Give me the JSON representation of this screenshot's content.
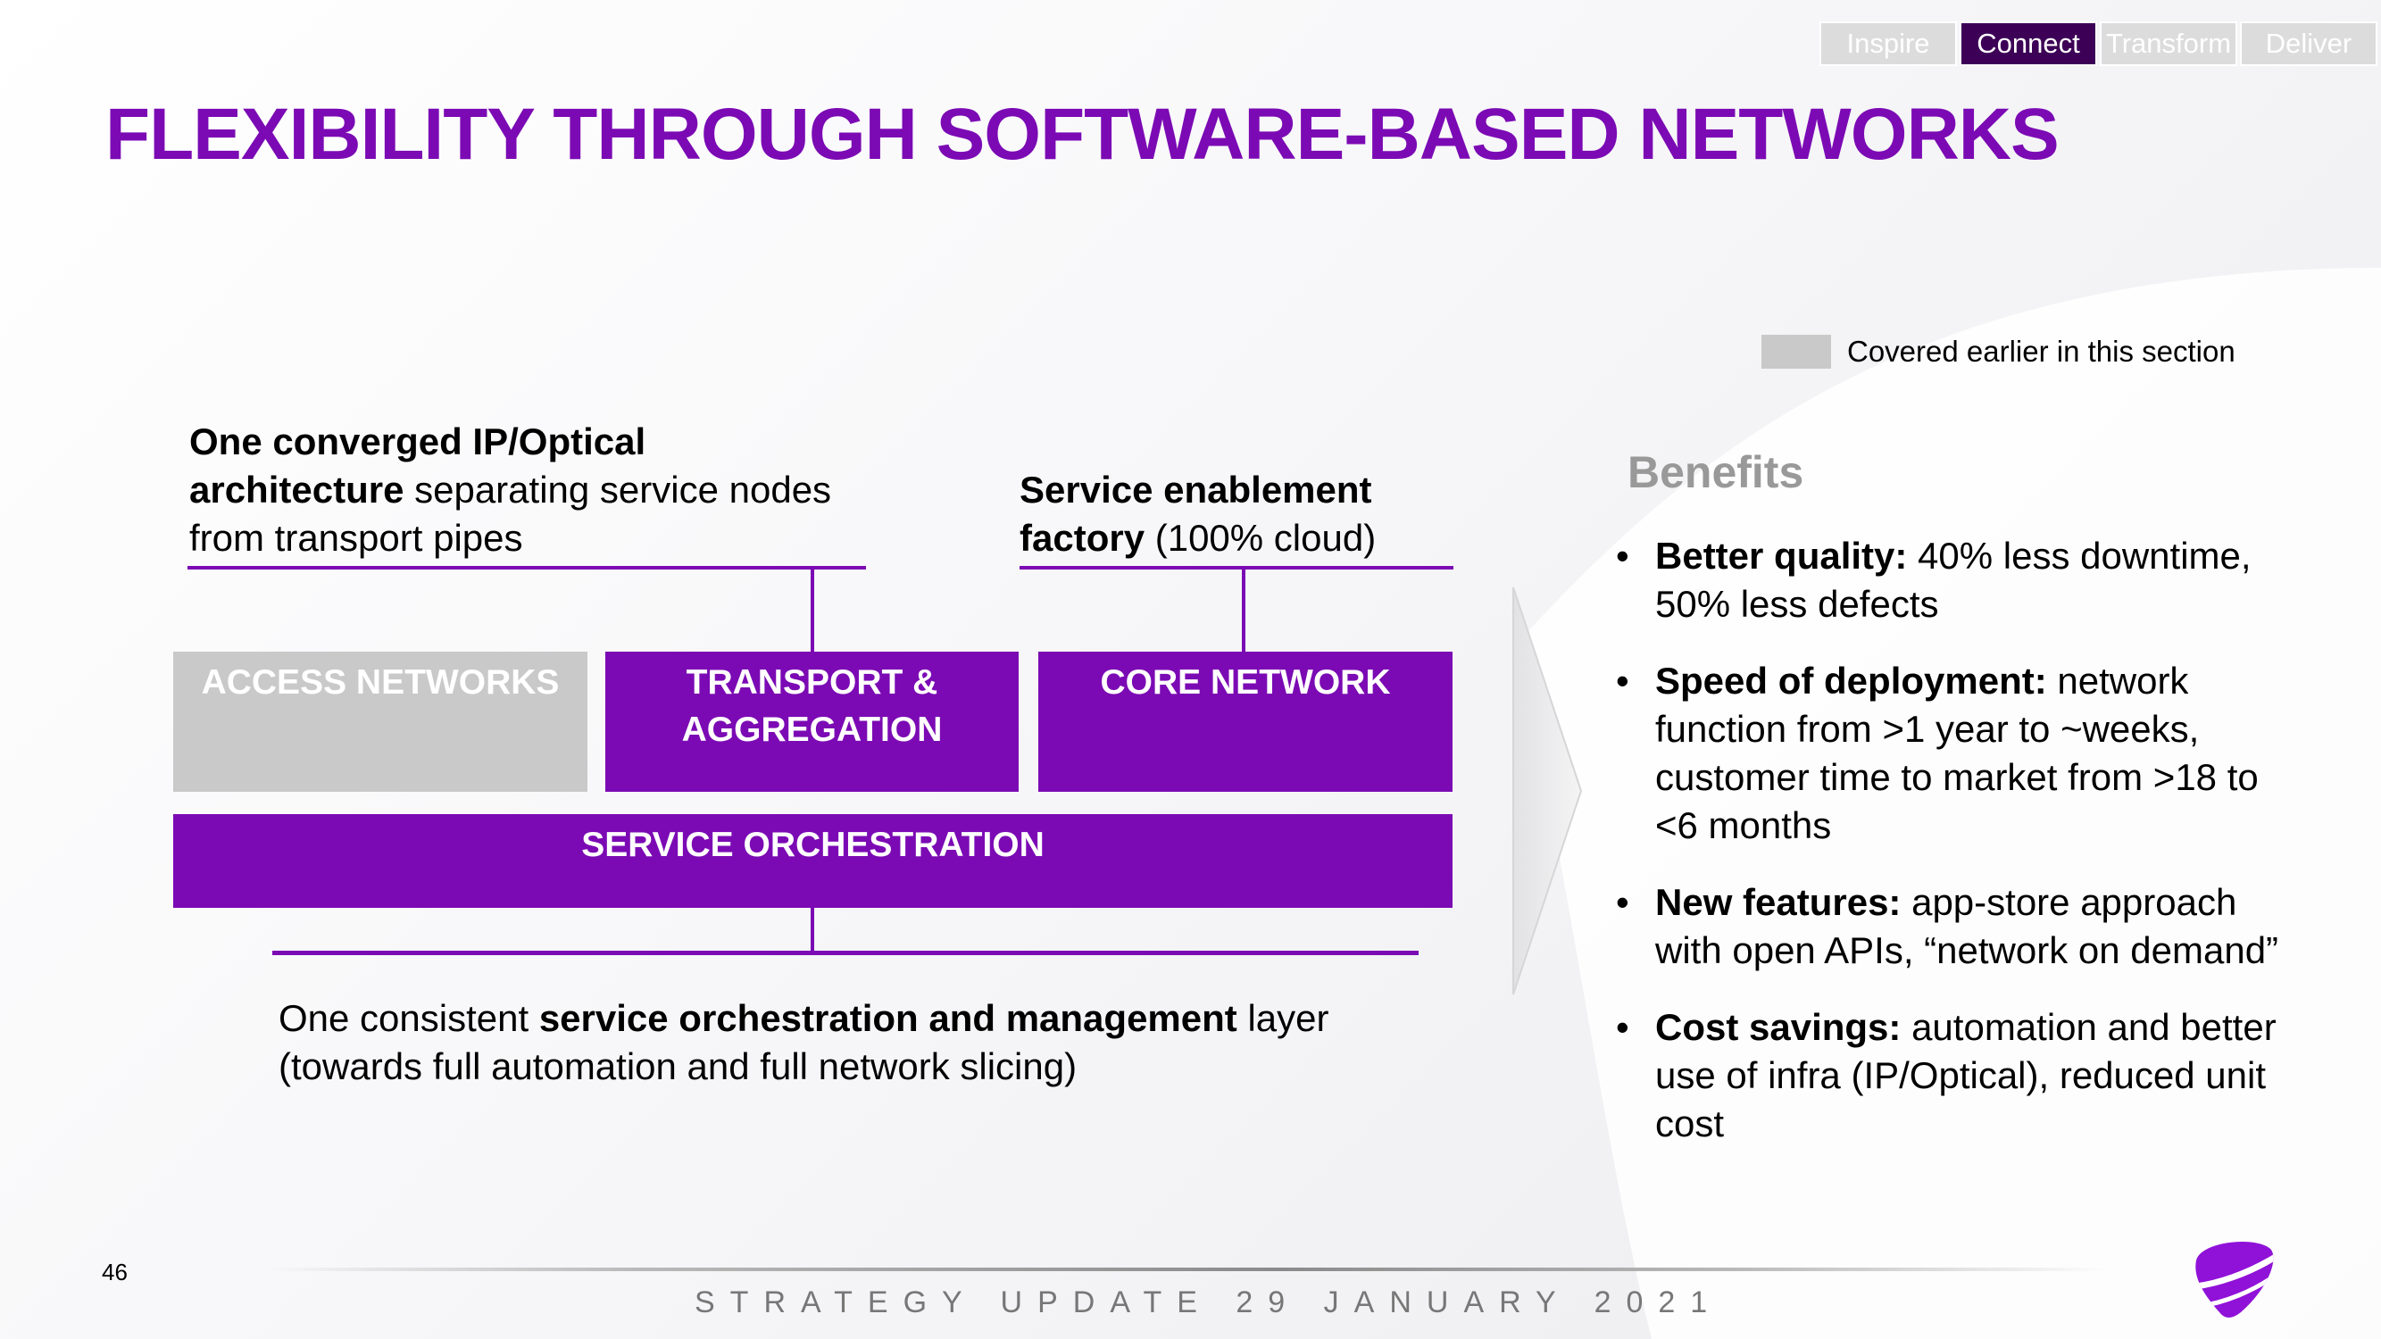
{
  "nav": {
    "tabs": [
      {
        "label": "Inspire",
        "active": false
      },
      {
        "label": "Connect",
        "active": true
      },
      {
        "label": "Transform",
        "active": false
      },
      {
        "label": "Deliver",
        "active": false
      }
    ]
  },
  "title": "FLEXIBILITY THROUGH SOFTWARE-BASED NETWORKS",
  "legend": {
    "label": "Covered earlier in this section",
    "swatch_color": "#c9c9c9"
  },
  "diagram": {
    "caption_left": {
      "bold": "One converged IP/Optical architecture",
      "regular": " separating service nodes from transport pipes"
    },
    "caption_right": {
      "bold": "Service enablement factory",
      "regular": " (100% cloud)"
    },
    "boxes": [
      {
        "label": "ACCESS NETWORKS",
        "covered_earlier": true
      },
      {
        "label": "TRANSPORT & AGGREGATION",
        "covered_earlier": false
      },
      {
        "label": "CORE NETWORK",
        "covered_earlier": false
      }
    ],
    "orchestration_label": "SERVICE ORCHESTRATION",
    "caption_bottom": {
      "prefix": "One consistent ",
      "bold": "service orchestration and management",
      "suffix": " layer (towards full automation and full network slicing)"
    }
  },
  "benefits": {
    "title": "Benefits",
    "bullet": "•",
    "items": [
      {
        "bold": "Better quality:",
        "text": " 40% less downtime, 50% less defects"
      },
      {
        "bold": "Speed of deployment:",
        "text": " network function from >1 year to ~weeks, customer time to market from >18 to <6 months"
      },
      {
        "bold": "New features:",
        "text": " app-store approach with open APIs, “network on demand”"
      },
      {
        "bold": "Cost savings:",
        "text": " automation and better use of infra (IP/Optical), reduced unit cost"
      }
    ]
  },
  "footer": {
    "page_number": "46",
    "text": "STRATEGY UPDATE 29 JANUARY 2021"
  },
  "colors": {
    "brand_purple": "#7b0ab4",
    "active_tab": "#3c0056",
    "inactive_grey": "#c9c9c9",
    "benefits_title": "#999999"
  }
}
